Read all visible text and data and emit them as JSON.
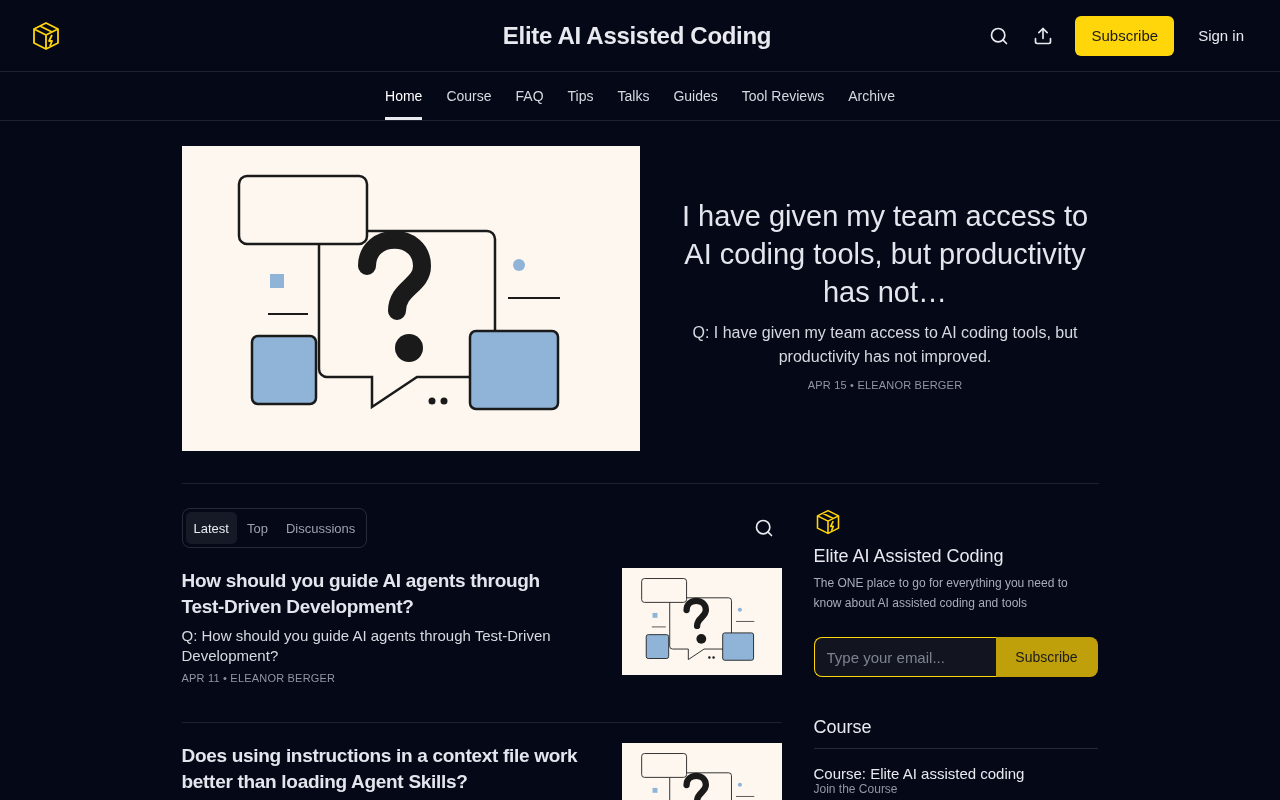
{
  "header": {
    "title": "Elite AI Assisted Coding",
    "subscribe": "Subscribe",
    "sign_in": "Sign in"
  },
  "nav": [
    {
      "label": "Home",
      "selected": true
    },
    {
      "label": "Course",
      "selected": false
    },
    {
      "label": "FAQ",
      "selected": false
    },
    {
      "label": "Tips",
      "selected": false
    },
    {
      "label": "Talks",
      "selected": false
    },
    {
      "label": "Guides",
      "selected": false
    },
    {
      "label": "Tool Reviews",
      "selected": false
    },
    {
      "label": "Archive",
      "selected": false
    }
  ],
  "hero": {
    "title": "I have given my team access to AI coding tools, but productivity has not…",
    "subtitle": "Q: I have given my team access to AI coding tools, but productivity has not improved.",
    "meta": "APR 15 • ELEANOR BERGER"
  },
  "feed_tabs": [
    {
      "label": "Latest",
      "selected": true
    },
    {
      "label": "Top",
      "selected": false
    },
    {
      "label": "Discussions",
      "selected": false
    }
  ],
  "posts": [
    {
      "title": "How should you guide AI agents through Test-Driven Development?",
      "subtitle": "Q: How should you guide AI agents through Test-Driven Development?",
      "meta": "APR 11 • ELEANOR BERGER"
    },
    {
      "title": "Does using instructions in a context file work better than loading Agent Skills?"
    }
  ],
  "sidebar": {
    "title": "Elite AI Assisted Coding",
    "description": "The ONE place to go for everything you need to know about AI assisted coding and tools",
    "email_placeholder": "Type your email...",
    "subscribe": "Subscribe",
    "section_title": "Course",
    "items": [
      {
        "title": "Course: Elite AI assisted coding",
        "subtitle": "Join the Course"
      }
    ]
  }
}
